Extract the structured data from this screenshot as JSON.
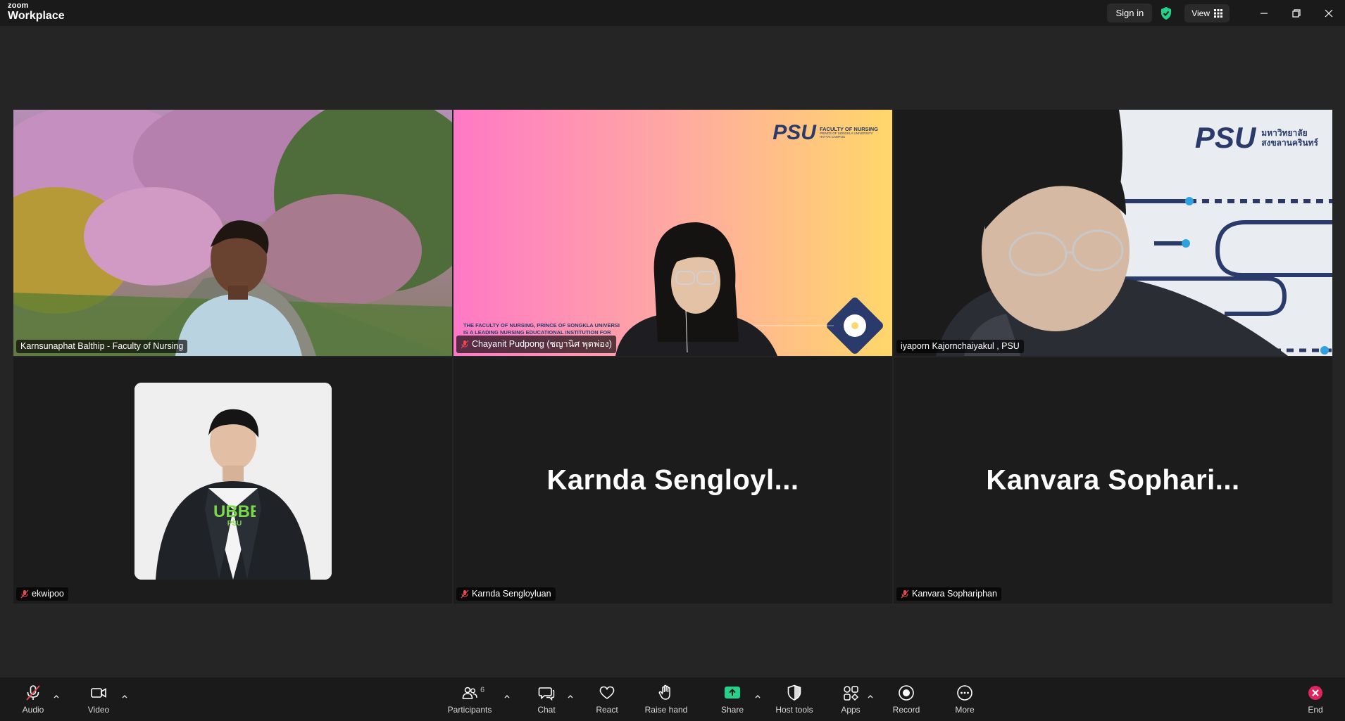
{
  "app": {
    "logo_top": "zoom",
    "logo_product": "Workplace"
  },
  "titlebar": {
    "signin": "Sign in",
    "view": "View"
  },
  "tiles": [
    {
      "name": "Karnsunaphat Balthip - Faculty of Nursing",
      "muted": false,
      "active": false
    },
    {
      "name": "Chayanit Pudpong (ชญานิศ พุดพ่อง)",
      "muted": true,
      "active": false
    },
    {
      "name": "iyaporn Kajornchaiyakul , PSU",
      "muted": false,
      "active": true
    },
    {
      "name": "ekwipoo",
      "muted": true,
      "active": false
    },
    {
      "name": "Karnda Sengloyluan",
      "muted": true,
      "active": false,
      "display_name": "Karnda  Sengloyl..."
    },
    {
      "name": "Kanvara Sophariphan",
      "muted": true,
      "active": false,
      "display_name": "Kanvara  Sophari..."
    }
  ],
  "slide": {
    "brand": "PSU",
    "faculty": "FACULTY OF NURSING",
    "university": "PRINCE OF SONGKLA UNIVERSITY",
    "campus": "HATYAI CAMPUS",
    "headline1": "THE FACULTY OF NURSING, PRINCE OF SONGKLA UNIVERSI",
    "headline2": "IS A LEADING NURSING EDUCATIONAL INSTITUTION FOR"
  },
  "psu_thai": {
    "line1": "มหาวิทยาลัย",
    "line2": "สงขลานครินทร์"
  },
  "shirt_text": {
    "big": "UBBE",
    "small": "PSU"
  },
  "toolbar": {
    "audio": "Audio",
    "video": "Video",
    "participants": "Participants",
    "participants_count": "6",
    "chat": "Chat",
    "react": "React",
    "raise_hand": "Raise hand",
    "share": "Share",
    "host_tools": "Host tools",
    "apps": "Apps",
    "record": "Record",
    "more": "More",
    "end": "End"
  },
  "colors": {
    "active_border": "#23d18b",
    "share_green": "#23d18b",
    "end_red": "#e0245e",
    "mute_red": "#e5484d"
  }
}
